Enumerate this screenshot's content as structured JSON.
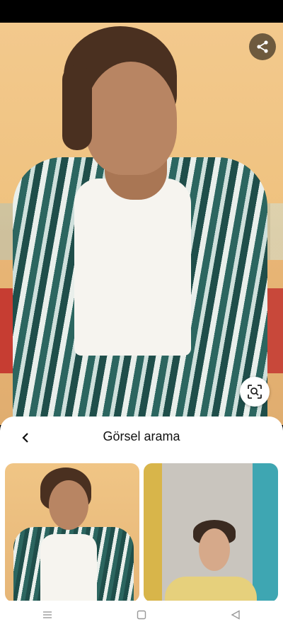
{
  "sheet": {
    "title": "Görsel arama"
  },
  "icons": {
    "share": "share-icon",
    "lens": "visual-search-icon",
    "back": "chevron-left-icon",
    "nav_recents": "menu-icon",
    "nav_home": "square-icon",
    "nav_back": "triangle-back-icon"
  },
  "results": [
    {
      "thumbnail": "man-striped-pajamas"
    },
    {
      "thumbnail": "man-curly-hair-yellow-jacket"
    }
  ],
  "colors": {
    "sheet_bg": "#ffffff",
    "title_text": "#111111"
  }
}
